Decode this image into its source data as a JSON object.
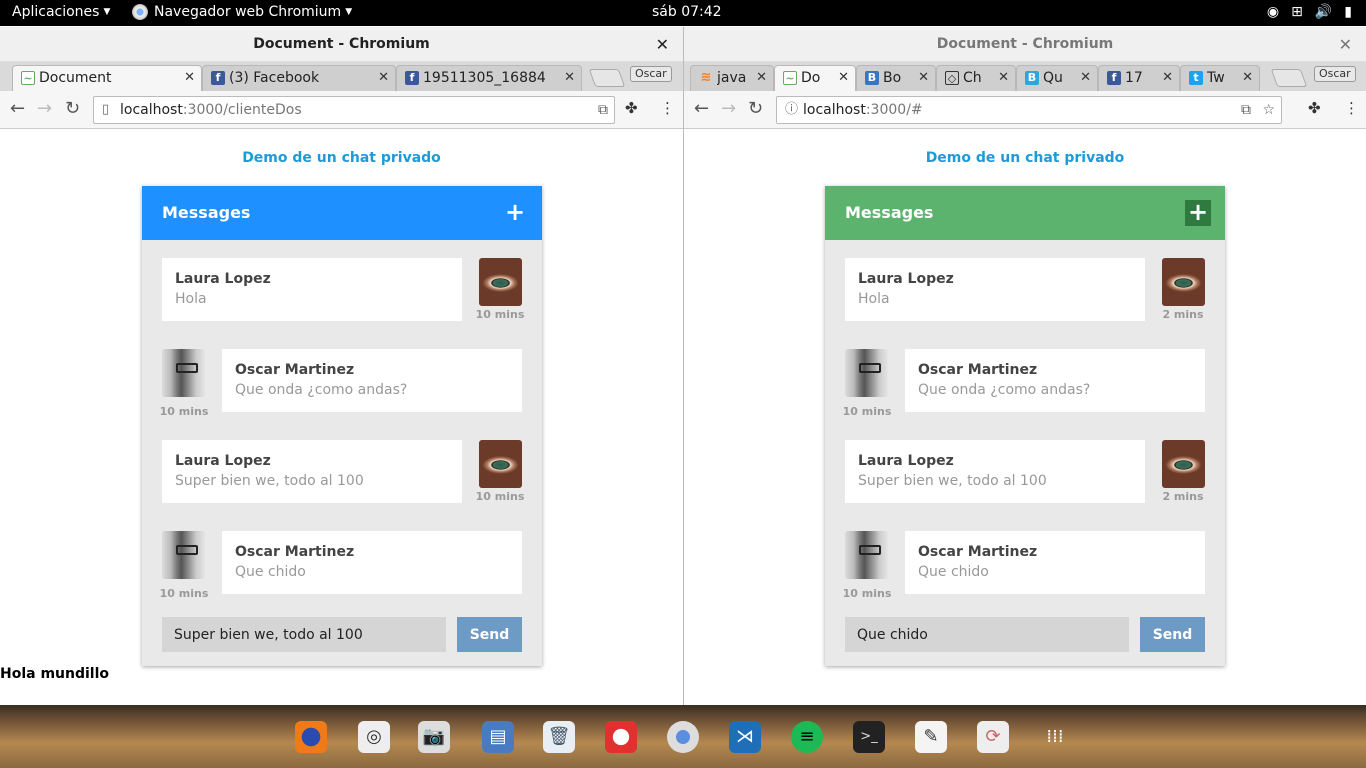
{
  "topbar": {
    "apps_label": "Aplicaciones",
    "browser_label": "Navegador web Chromium",
    "clock": "sáb 07:42",
    "tray_icons": [
      "power-indicator-icon",
      "network-icon",
      "volume-icon",
      "battery-icon"
    ]
  },
  "left_window": {
    "title": "Document - Chromium",
    "tabs": [
      {
        "label": "Document",
        "favicon": "app-icon"
      },
      {
        "label": "(3) Facebook",
        "favicon": "facebook-icon"
      },
      {
        "label": "19511305_16884",
        "favicon": "facebook-icon"
      }
    ],
    "profile": "Oscar",
    "url_host": "localhost",
    "url_path": ":3000/clienteDos",
    "page": {
      "demo_title": "Demo de un chat privado",
      "header_title": "Messages",
      "header_color": "#1e90ff",
      "messages": [
        {
          "name": "Laura Lopez",
          "text": "Hola",
          "time": "10 mins"
        },
        {
          "name": "Oscar Martinez",
          "text": "Que onda ¿como andas?",
          "time": "10 mins"
        },
        {
          "name": "Laura Lopez",
          "text": "Super bien we, todo al 100",
          "time": "10 mins"
        },
        {
          "name": "Oscar Martinez",
          "text": "Que chido",
          "time": "10 mins"
        }
      ],
      "input_value": "Super bien we, todo al 100",
      "send_label": "Send",
      "footer_text": "Hola mundillo"
    }
  },
  "right_window": {
    "title": "Document - Chromium",
    "tabs": [
      {
        "label": "java",
        "favicon": "stackoverflow-icon"
      },
      {
        "label": "Do",
        "favicon": "app-icon"
      },
      {
        "label": "Bo",
        "favicon": "bootstrap-icon"
      },
      {
        "label": "Ch",
        "favicon": "codepen-icon"
      },
      {
        "label": "Qu",
        "favicon": "b-icon"
      },
      {
        "label": "17",
        "favicon": "facebook-icon"
      },
      {
        "label": "Tw",
        "favicon": "twitter-icon"
      }
    ],
    "profile": "Oscar",
    "url_host": "localhost",
    "url_path": ":3000/#",
    "page": {
      "demo_title": "Demo de un chat privado",
      "header_title": "Messages",
      "header_color": "#5cb36e",
      "messages": [
        {
          "name": "Laura Lopez",
          "text": "Hola",
          "time": "2 mins"
        },
        {
          "name": "Oscar Martinez",
          "text": "Que onda ¿como andas?",
          "time": "10 mins"
        },
        {
          "name": "Laura Lopez",
          "text": "Super bien we, todo al 100",
          "time": "2 mins"
        },
        {
          "name": "Oscar Martinez",
          "text": "Que chido",
          "time": "10 mins"
        }
      ],
      "input_value": "Que chido",
      "send_label": "Send"
    }
  },
  "dock": [
    "firefox-icon",
    "speaker-icon",
    "camera-icon",
    "files-icon",
    "trash-icon",
    "help-icon",
    "chromium-icon",
    "vscode-icon",
    "spotify-icon",
    "terminal-icon",
    "text-editor-icon",
    "update-icon",
    "app-grid-icon"
  ]
}
